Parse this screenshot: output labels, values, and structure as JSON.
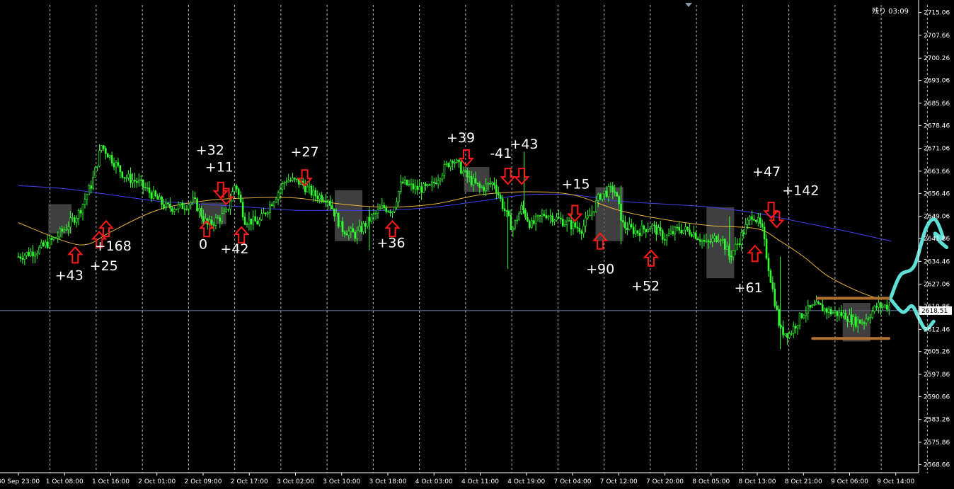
{
  "colors": {
    "background": "#000000",
    "candle": "#33ff33",
    "ma_fast": "#e8b33a",
    "ma_slow": "#4040ee",
    "grid": "#bbbbbb",
    "arrow": "#ff1a1a",
    "zone": "#5a5a5a",
    "range_line": "#b07030",
    "projection": "#5ee0d6",
    "price_line": "#7a86b8"
  },
  "countdown": "残り 03:09",
  "current_price": {
    "value": 2618.51,
    "label": "2618.51"
  },
  "chart_data": {
    "type": "candlestick",
    "title": "",
    "xlabel": "",
    "ylabel": "",
    "ylim": [
      2566.0,
      2717.5
    ],
    "y_ticks": [
      "2715.06",
      "2707.66",
      "2700.26",
      "2693.06",
      "2685.66",
      "2678.46",
      "2671.06",
      "2663.66",
      "2656.46",
      "2649.06",
      "2641.86",
      "2634.46",
      "2627.06",
      "2619.86",
      "2612.46",
      "2605.26",
      "2597.86",
      "2590.66",
      "2583.26",
      "2575.86",
      "2568.66"
    ],
    "x_ticks": [
      "30 Sep 23:00",
      "1 Oct 08:00",
      "1 Oct 16:00",
      "2 Oct 01:00",
      "2 Oct 09:00",
      "2 Oct 17:00",
      "3 Oct 02:00",
      "3 Oct 10:00",
      "3 Oct 18:00",
      "4 Oct 03:00",
      "4 Oct 11:00",
      "4 Oct 19:00",
      "7 Oct 04:00",
      "7 Oct 12:00",
      "7 Oct 20:00",
      "8 Oct 05:00",
      "8 Oct 13:00",
      "8 Oct 21:00",
      "9 Oct 06:00",
      "9 Oct 14:00"
    ],
    "grid_after_ticks": [
      2,
      5,
      9,
      13,
      16
    ],
    "price_path": [
      [
        0,
        2636
      ],
      [
        0.4,
        2638
      ],
      [
        0.8,
        2642
      ],
      [
        1,
        2645
      ],
      [
        1.3,
        2650
      ],
      [
        1.6,
        2660
      ],
      [
        1.8,
        2672
      ],
      [
        2.0,
        2668
      ],
      [
        2.3,
        2662
      ],
      [
        2.6,
        2660
      ],
      [
        2.9,
        2656
      ],
      [
        3.2,
        2652
      ],
      [
        3.5,
        2652
      ],
      [
        3.8,
        2654
      ],
      [
        4.1,
        2646
      ],
      [
        4.5,
        2650
      ],
      [
        4.7,
        2660
      ],
      [
        4.9,
        2648
      ],
      [
        5.2,
        2647
      ],
      [
        5.5,
        2654
      ],
      [
        5.8,
        2661
      ],
      [
        6.1,
        2660
      ],
      [
        6.4,
        2656
      ],
      [
        6.7,
        2655
      ],
      [
        7.0,
        2645
      ],
      [
        7.3,
        2643
      ],
      [
        7.6,
        2648
      ],
      [
        7.9,
        2652
      ],
      [
        8.1,
        2651
      ],
      [
        8.3,
        2660
      ],
      [
        8.6,
        2658
      ],
      [
        8.9,
        2658
      ],
      [
        9.2,
        2664
      ],
      [
        9.4,
        2668
      ],
      [
        9.7,
        2662
      ],
      [
        10.0,
        2658
      ],
      [
        10.3,
        2660
      ],
      [
        10.5,
        2652
      ],
      [
        10.7,
        2645
      ],
      [
        10.9,
        2652
      ],
      [
        11.1,
        2646
      ],
      [
        11.4,
        2650
      ],
      [
        11.7,
        2648
      ],
      [
        12.0,
        2646
      ],
      [
        12.2,
        2645
      ],
      [
        12.4,
        2650
      ],
      [
        12.6,
        2656
      ],
      [
        12.9,
        2658
      ],
      [
        13.1,
        2646
      ],
      [
        13.4,
        2644
      ],
      [
        13.7,
        2646
      ],
      [
        14.0,
        2642
      ],
      [
        14.3,
        2645
      ],
      [
        14.6,
        2644
      ],
      [
        14.9,
        2640
      ],
      [
        15.2,
        2643
      ],
      [
        15.4,
        2636
      ],
      [
        15.6,
        2641
      ],
      [
        15.9,
        2650
      ],
      [
        16.1,
        2645
      ],
      [
        16.3,
        2628
      ],
      [
        16.5,
        2612
      ],
      [
        16.7,
        2611
      ],
      [
        17.0,
        2618
      ],
      [
        17.3,
        2620
      ],
      [
        17.6,
        2618
      ],
      [
        17.9,
        2617
      ],
      [
        18.1,
        2615
      ],
      [
        18.3,
        2615
      ],
      [
        18.6,
        2620
      ],
      [
        18.9,
        2620
      ]
    ],
    "ma_fast": [
      [
        0,
        2647
      ],
      [
        1,
        2641
      ],
      [
        1.5,
        2640
      ],
      [
        2,
        2644
      ],
      [
        3,
        2651
      ],
      [
        4,
        2654
      ],
      [
        5,
        2655
      ],
      [
        6,
        2655
      ],
      [
        7,
        2653
      ],
      [
        8,
        2652
      ],
      [
        9,
        2653
      ],
      [
        10,
        2656
      ],
      [
        11,
        2657
      ],
      [
        12,
        2656
      ],
      [
        13,
        2651
      ],
      [
        14,
        2648
      ],
      [
        15,
        2646
      ],
      [
        16,
        2645
      ],
      [
        16.5,
        2641
      ],
      [
        17,
        2636
      ],
      [
        17.5,
        2630
      ],
      [
        18,
        2626
      ],
      [
        18.5,
        2623
      ],
      [
        18.9,
        2622
      ]
    ],
    "ma_slow": [
      [
        0,
        2659
      ],
      [
        1,
        2658
      ],
      [
        2,
        2656
      ],
      [
        3,
        2654
      ],
      [
        4,
        2653
      ],
      [
        5,
        2652
      ],
      [
        6,
        2651
      ],
      [
        7,
        2651
      ],
      [
        8,
        2651
      ],
      [
        9,
        2652
      ],
      [
        10,
        2654
      ],
      [
        11,
        2656
      ],
      [
        12,
        2656
      ],
      [
        13,
        2654
      ],
      [
        14,
        2653
      ],
      [
        15,
        2652
      ],
      [
        16,
        2650
      ],
      [
        17,
        2647
      ],
      [
        18,
        2644
      ],
      [
        18.9,
        2641
      ]
    ],
    "zones": [
      [
        0.65,
        1.15,
        2643.5,
        2653
      ],
      [
        3.95,
        4.5,
        2646.5,
        2653.5
      ],
      [
        6.85,
        7.45,
        2641,
        2657.5
      ],
      [
        9.65,
        10.2,
        2657,
        2665
      ],
      [
        12.5,
        13.1,
        2641,
        2658.5
      ],
      [
        14.9,
        15.5,
        2629,
        2652
      ],
      [
        17.85,
        18.45,
        2608.5,
        2621
      ]
    ],
    "range_lines": [
      [
        17.3,
        18.85,
        2622.5
      ],
      [
        17.2,
        18.85,
        2609.5
      ]
    ],
    "arrows": [
      {
        "dir": "up",
        "x": 1.23,
        "y": 2636.5
      },
      {
        "dir": "up",
        "x": 1.75,
        "y": 2641.5
      },
      {
        "dir": "up",
        "x": 1.9,
        "y": 2645
      },
      {
        "dir": "up",
        "x": 4.08,
        "y": 2645
      },
      {
        "dir": "down",
        "x": 4.38,
        "y": 2657.5
      },
      {
        "dir": "down",
        "x": 4.5,
        "y": 2655.5
      },
      {
        "dir": "up",
        "x": 4.83,
        "y": 2643
      },
      {
        "dir": "down",
        "x": 6.2,
        "y": 2661.5
      },
      {
        "dir": "up",
        "x": 8.1,
        "y": 2645
      },
      {
        "dir": "down",
        "x": 9.7,
        "y": 2668
      },
      {
        "dir": "down",
        "x": 10.6,
        "y": 2662
      },
      {
        "dir": "down",
        "x": 10.9,
        "y": 2662
      },
      {
        "dir": "down",
        "x": 12.05,
        "y": 2650
      },
      {
        "dir": "up",
        "x": 12.6,
        "y": 2641
      },
      {
        "dir": "up",
        "x": 13.7,
        "y": 2635.5
      },
      {
        "dir": "up",
        "x": 15.95,
        "y": 2637
      },
      {
        "dir": "down",
        "x": 16.3,
        "y": 2651
      },
      {
        "dir": "down",
        "x": 16.42,
        "y": 2648
      }
    ],
    "labels": [
      {
        "text": "+43",
        "x": 1.1,
        "y": 2628.5
      },
      {
        "text": "+25",
        "x": 1.85,
        "y": 2631.5
      },
      {
        "text": "+168",
        "x": 2.05,
        "y": 2638
      },
      {
        "text": "+32",
        "x": 4.15,
        "y": 2669
      },
      {
        "text": "+11",
        "x": 4.35,
        "y": 2663.5
      },
      {
        "text": "0",
        "x": 4.0,
        "y": 2638.5
      },
      {
        "text": "+42",
        "x": 4.68,
        "y": 2637
      },
      {
        "text": "+27",
        "x": 6.2,
        "y": 2668.5
      },
      {
        "text": "+36",
        "x": 8.07,
        "y": 2639
      },
      {
        "text": "+39",
        "x": 9.58,
        "y": 2673
      },
      {
        "text": "-41",
        "x": 10.45,
        "y": 2668
      },
      {
        "text": "+43",
        "x": 10.95,
        "y": 2671
      },
      {
        "text": "+15",
        "x": 12.07,
        "y": 2658
      },
      {
        "text": "+90",
        "x": 12.6,
        "y": 2630.5
      },
      {
        "text": "+52",
        "x": 13.58,
        "y": 2625
      },
      {
        "text": "+61",
        "x": 15.81,
        "y": 2624.5
      },
      {
        "text": "+47",
        "x": 16.2,
        "y": 2662
      },
      {
        "text": "+142",
        "x": 16.94,
        "y": 2656
      }
    ]
  }
}
